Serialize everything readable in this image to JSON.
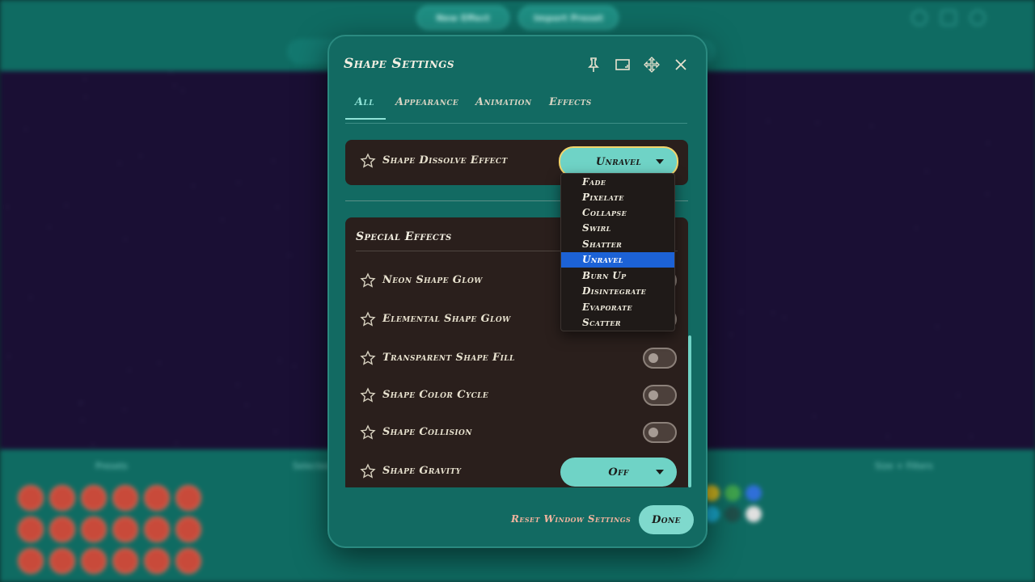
{
  "background": {
    "top_buttons": [
      "New Effect",
      "Import Preset"
    ],
    "bottom_labels": [
      "Presets",
      "Selected",
      "Size + Filters"
    ]
  },
  "dialog": {
    "title": "Shape Settings",
    "header_icons": [
      "pin-icon",
      "aspect-ratio-icon",
      "move-icon",
      "close-icon"
    ],
    "tabs": [
      {
        "label": "All",
        "active": true
      },
      {
        "label": "Appearance",
        "active": false
      },
      {
        "label": "Animation",
        "active": false
      },
      {
        "label": "Effects",
        "active": false
      }
    ],
    "dissolve": {
      "label": "Shape Dissolve Effect",
      "value": "Unravel"
    },
    "special_effects": {
      "title": "Special Effects",
      "rows": [
        {
          "label": "Neon Shape Glow",
          "control": "toggle",
          "on": false
        },
        {
          "label": "Elemental Shape Glow",
          "control": "toggle",
          "on": false
        },
        {
          "label": "Transparent Shape Fill",
          "control": "toggle",
          "on": false
        },
        {
          "label": "Shape Color Cycle",
          "control": "toggle",
          "on": false
        },
        {
          "label": "Shape Collision",
          "control": "toggle",
          "on": false
        },
        {
          "label": "Shape Gravity",
          "control": "select",
          "value": "Off"
        }
      ]
    },
    "footer": {
      "reset_label": "Reset Window Settings",
      "done_label": "Done"
    }
  },
  "dissolve_menu": {
    "options": [
      "Fade",
      "Pixelate",
      "Collapse",
      "Swirl",
      "Shatter",
      "Unravel",
      "Burn Up",
      "Disintegrate",
      "Evaporate",
      "Scatter"
    ],
    "selected": "Unravel"
  },
  "colors": {
    "dialog_bg": "#126a62",
    "card_bg": "#2a1f1c",
    "accent": "#6fd3c6",
    "selected_option": "#1c62d6",
    "reset_link": "#f0b39d"
  }
}
